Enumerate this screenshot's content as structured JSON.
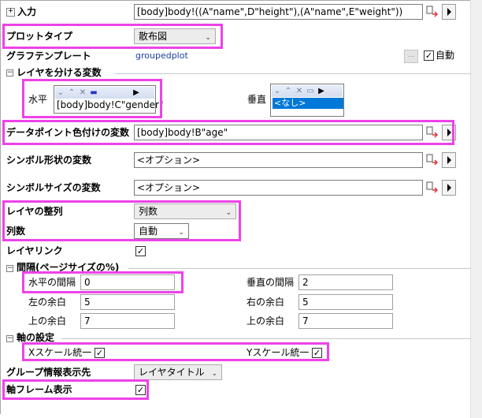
{
  "input": {
    "label": "入力",
    "value": "[body]body!((A\"name\",D\"height\"),(A\"name\",E\"weight\"))"
  },
  "plot_type": {
    "label": "プロットタイプ",
    "value": "散布図"
  },
  "graph_template": {
    "label": "グラフテンプレート",
    "value": "groupedplot",
    "browse_label": "...",
    "auto_label": "自動"
  },
  "layer_split": {
    "section_label": "レイヤを分ける変数",
    "horizontal_label": "水平",
    "horizontal_value": "[body]body!C\"gender\"",
    "vertical_label": "垂直",
    "vertical_value": "<なし>"
  },
  "color_var": {
    "label": "データポイント色付けの変数",
    "value": "[body]body!B\"age\""
  },
  "symbol_shape_var": {
    "label": "シンボル形状の変数",
    "value": "<オプション>"
  },
  "symbol_size_var": {
    "label": "シンボルサイズの変数",
    "value": "<オプション>"
  },
  "layer_arrange": {
    "label": "レイヤの整列",
    "value": "列数"
  },
  "columns": {
    "label": "列数",
    "value": "自動"
  },
  "layer_link": {
    "label": "レイヤリンク"
  },
  "spacing": {
    "section_label": "間隔(ページサイズの%)",
    "h_gap_label": "水平の間隔",
    "h_gap_value": "0",
    "v_gap_label": "垂直の間隔",
    "v_gap_value": "2",
    "left_label": "左の余白",
    "left_value": "5",
    "right_label": "右の余白",
    "right_value": "5",
    "top_label": "上の余白",
    "top_value": "7",
    "bottom_label": "上の余白",
    "bottom_value": "7"
  },
  "axis": {
    "section_label": "軸の設定",
    "x_label": "Xスケール統一",
    "y_label": "Yスケール統一"
  },
  "group_info": {
    "label": "グループ情報表示先",
    "value": "レイヤタイトル"
  },
  "axis_frame": {
    "label": "軸フレーム表示"
  },
  "highlight_color": "#ee42e8"
}
